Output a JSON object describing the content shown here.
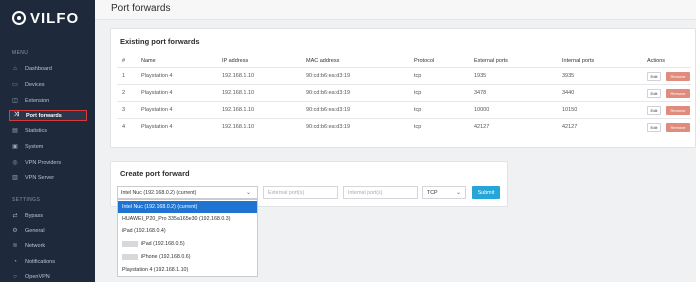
{
  "brand": {
    "name": "VILFO"
  },
  "sidebar": {
    "menu_label": "MENU",
    "settings_label": "SETTINGS",
    "menu_items": [
      {
        "label": "Dashboard",
        "icon": "home-icon"
      },
      {
        "label": "Devices",
        "icon": "devices-icon"
      },
      {
        "label": "Extension",
        "icon": "extension-icon"
      },
      {
        "label": "Port forwards",
        "icon": "shuffle-icon",
        "active": true
      },
      {
        "label": "Statistics",
        "icon": "statistics-icon"
      },
      {
        "label": "System",
        "icon": "system-icon"
      },
      {
        "label": "VPN Providers",
        "icon": "vpn-providers-icon"
      },
      {
        "label": "VPN Server",
        "icon": "vpn-server-icon"
      }
    ],
    "settings_items": [
      {
        "label": "Bypass",
        "icon": "bypass-icon"
      },
      {
        "label": "General",
        "icon": "general-icon"
      },
      {
        "label": "Network",
        "icon": "network-icon"
      },
      {
        "label": "Notifications",
        "icon": "bell-icon"
      },
      {
        "label": "OpenVPN",
        "icon": "openvpn-icon"
      }
    ]
  },
  "page": {
    "title": "Port forwards"
  },
  "existing": {
    "title": "Existing port forwards",
    "columns": [
      "#",
      "Name",
      "IP address",
      "MAC address",
      "Protocol",
      "External ports",
      "Internal ports",
      "Actions"
    ],
    "rows": [
      {
        "num": "1",
        "name": "Playstation 4",
        "ip": "192.168.1.10",
        "mac": "90:cd:b6:ea:d3:19",
        "protocol": "tcp",
        "external": "1935",
        "internal": "3935"
      },
      {
        "num": "2",
        "name": "Playstation 4",
        "ip": "192.168.1.10",
        "mac": "90:cd:b6:ea:d3:19",
        "protocol": "tcp",
        "external": "3478",
        "internal": "3440"
      },
      {
        "num": "3",
        "name": "Playstation 4",
        "ip": "192.168.1.10",
        "mac": "90:cd:b6:ea:d3:19",
        "protocol": "tcp",
        "external": "10000",
        "internal": "10150"
      },
      {
        "num": "4",
        "name": "Playstation 4",
        "ip": "192.168.1.10",
        "mac": "90:cd:b6:ea:d3:19",
        "protocol": "tcp",
        "external": "42127",
        "internal": "42127"
      }
    ],
    "edit_label": "Edit",
    "remove_label": "Remove"
  },
  "create": {
    "title": "Create port forward",
    "device_selected": "Intel Nuc (192.168.0.2) (current)",
    "external_placeholder": "External port(s)",
    "internal_placeholder": "Internal port(s)",
    "protocol": "TCP",
    "submit_label": "Submit",
    "options": [
      {
        "label": "Intel Nuc (192.168.0.2) (current)",
        "selected": true
      },
      {
        "label": "HUAWEI_P20_Pro 335a165e30 (192.168.0.3)"
      },
      {
        "label": "iPad (192.168.0.4)"
      },
      {
        "label": "iPad (192.168.0.5)",
        "redacted": true
      },
      {
        "label": "iPhone (192.168.0.6)",
        "redacted": true
      },
      {
        "label": "Playstation 4 (192.168.1.10)"
      }
    ]
  },
  "colors": {
    "sidebar": "#1e2a3b",
    "accent": "#26a6d8",
    "remove": "#e08b7b",
    "selected": "#1e74d0",
    "active_border": "#d83a3a"
  }
}
